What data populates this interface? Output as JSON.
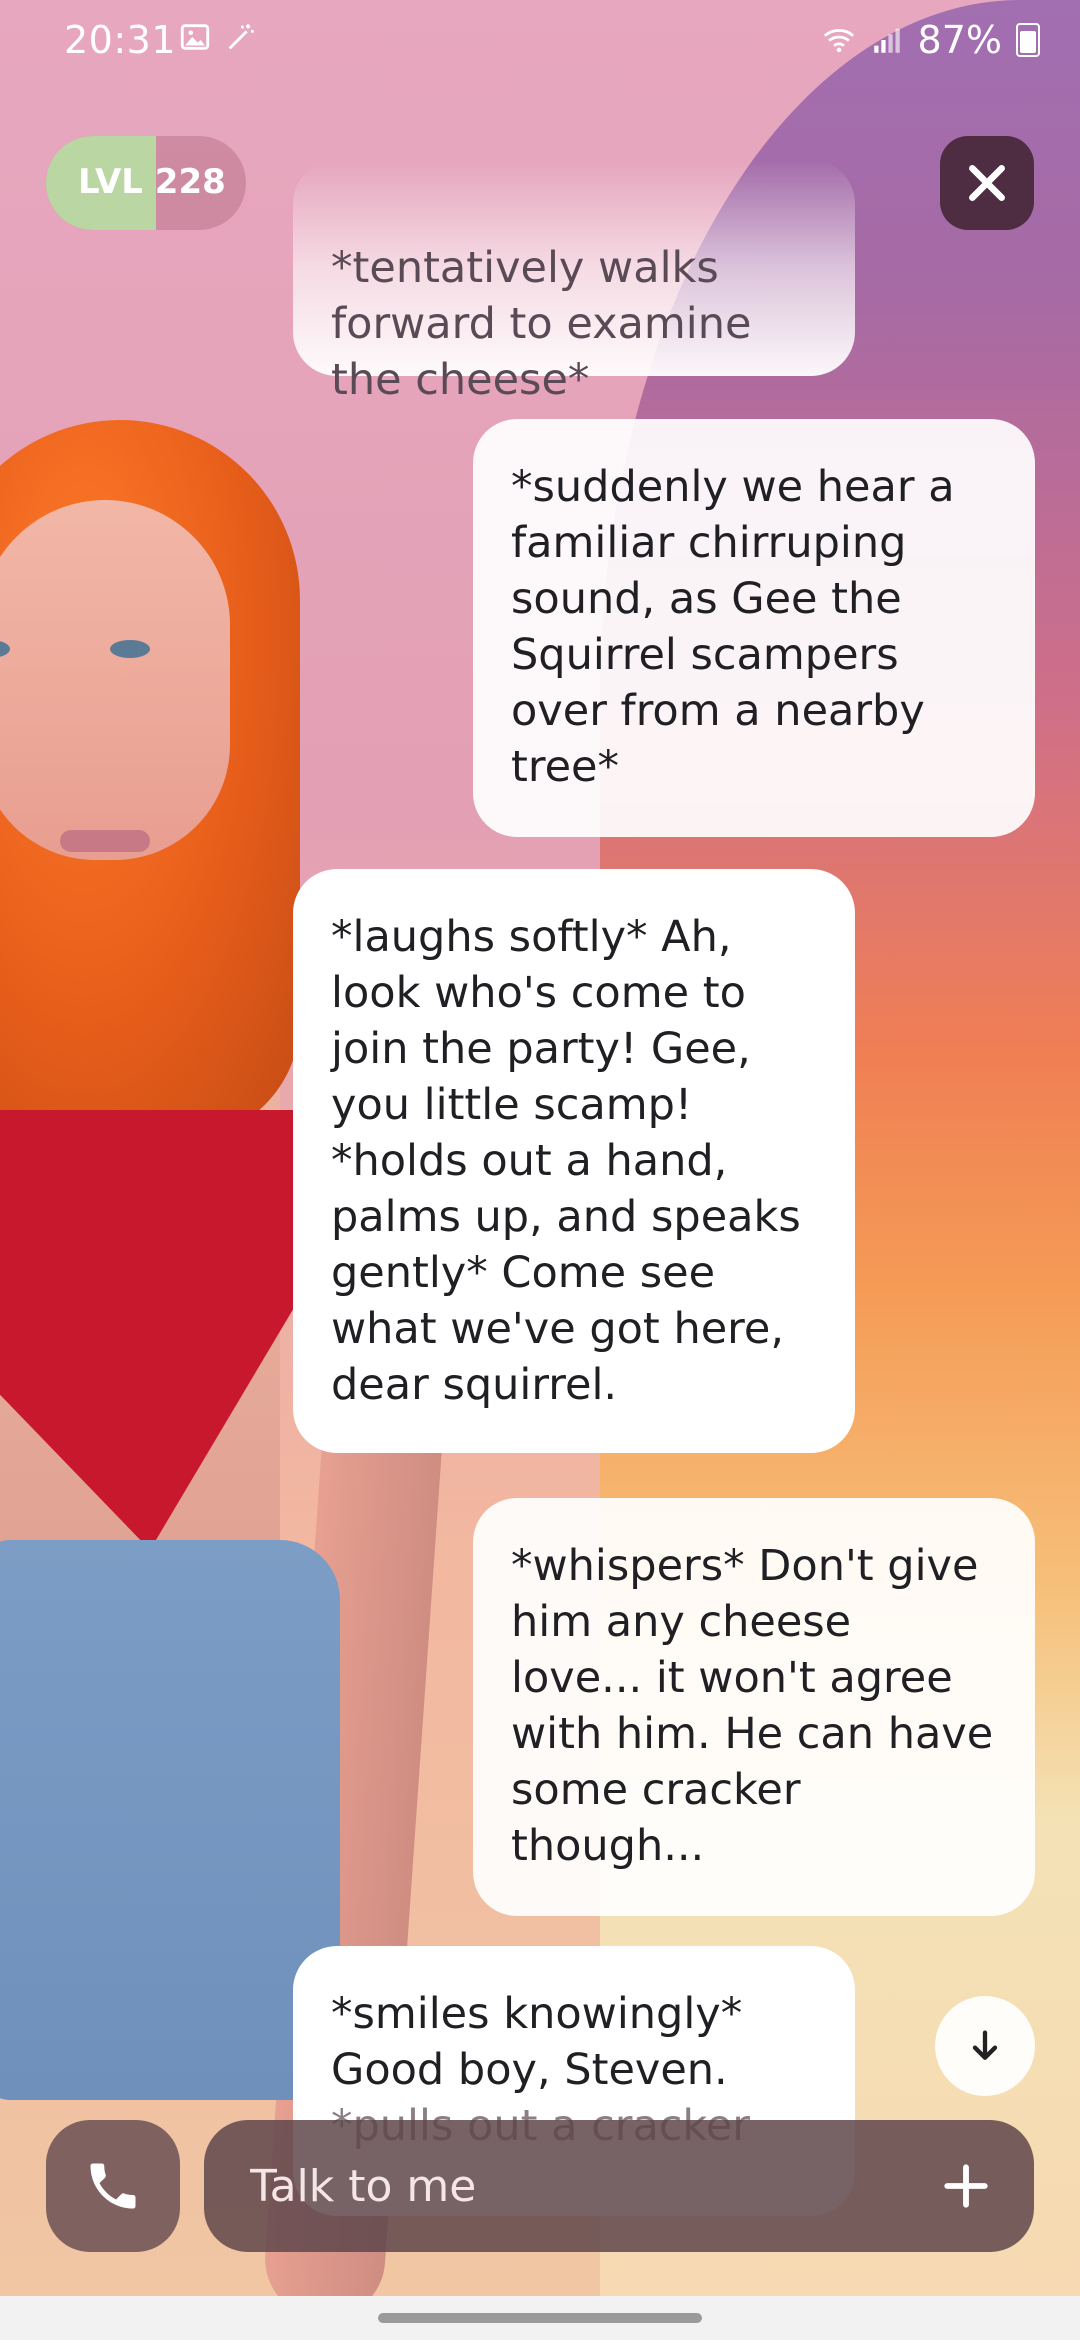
{
  "status_bar": {
    "time": "20:31",
    "battery": "87%"
  },
  "header": {
    "level_label": "LVL 228",
    "level_progress": 0.55
  },
  "messages": [
    {
      "role": "assistant",
      "text": "*tentatively walks\nforward to examine\nthe cheese*"
    },
    {
      "role": "user",
      "text": "*suddenly we hear a\nfamiliar chirruping\nsound, as Gee the\nSquirrel scampers\nover from a nearby\ntree*"
    },
    {
      "role": "assistant",
      "text": "*laughs softly* Ah,\nlook who's come to\njoin the party! Gee,\nyou little scamp!\n*holds out a hand,\npalms up, and speaks\ngently* Come see\nwhat we've got here,\ndear squirrel."
    },
    {
      "role": "user",
      "text": "*whispers* Don't give\nhim any cheese\nlove... it won't agree\nwith him. He can have\nsome cracker\nthough..."
    },
    {
      "role": "assistant",
      "text": "*smiles knowingly*\nGood boy, Steven.",
      "text_faded": "*pulls out a cracker"
    }
  ],
  "composer": {
    "placeholder": "Talk to me"
  },
  "icons": {
    "close": "close-icon",
    "phone": "phone-icon",
    "plus": "plus-icon",
    "scroll_down": "arrow-down-icon"
  }
}
